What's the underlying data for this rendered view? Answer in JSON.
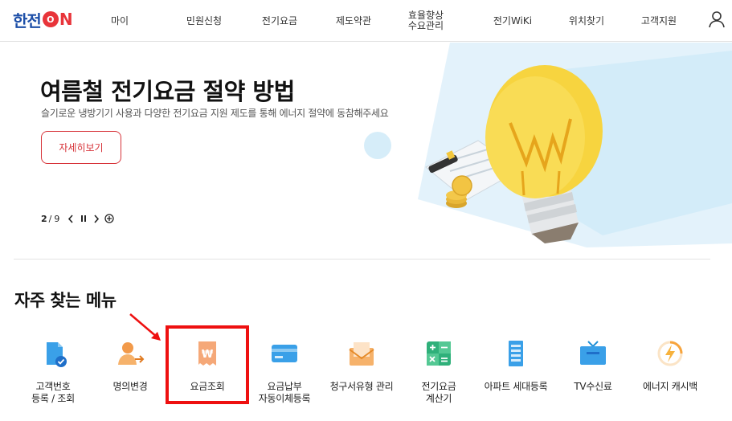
{
  "header": {
    "logo": {
      "main": "한전",
      "on_o": "O",
      "on_n": "N"
    },
    "nav": [
      {
        "label": "마이"
      },
      {
        "label": "민원신청"
      },
      {
        "label": "전기요금"
      },
      {
        "label": "제도약관"
      },
      {
        "label": "효율향상\n수요관리"
      },
      {
        "label": "전기WiKi"
      },
      {
        "label": "위치찾기"
      },
      {
        "label": "고객지원"
      }
    ],
    "user_icon": "user-icon"
  },
  "banner": {
    "title": "여름철 전기요금 절약 방법",
    "subtitle": "슬기로운 냉방기기 사용과 다양한 전기요금 지원 제도를 통해 에너지 절약에 동참해주세요",
    "button": "자세히보기",
    "pager": {
      "current": "2",
      "total": "9"
    }
  },
  "quick_menu": {
    "title": "자주 찾는 메뉴",
    "items": [
      {
        "label": "고객번호\n등록 / 조회",
        "icon": "customer-number-icon"
      },
      {
        "label": "명의변경",
        "icon": "name-change-icon"
      },
      {
        "label": "요금조회",
        "icon": "bill-inquiry-icon"
      },
      {
        "label": "요금납부\n자동이체등록",
        "icon": "card-payment-icon"
      },
      {
        "label": "청구서유형 관리",
        "icon": "envelope-icon"
      },
      {
        "label": "전기요금\n계산기",
        "icon": "calculator-icon"
      },
      {
        "label": "아파트 세대등록",
        "icon": "apartment-icon"
      },
      {
        "label": "TV수신료",
        "icon": "tv-icon"
      },
      {
        "label": "에너지 캐시백",
        "icon": "energy-cashback-icon"
      }
    ],
    "highlighted": "요금조회"
  },
  "colors": {
    "brand_blue": "#1d4fa8",
    "brand_red": "#e8343a",
    "button_red": "#d7343a",
    "highlight": "#ee1010",
    "icon_blue": "#2f9be6",
    "icon_orange": "#f29a4a",
    "icon_green": "#2fb07a",
    "bulb_yellow": "#f7d43f"
  }
}
